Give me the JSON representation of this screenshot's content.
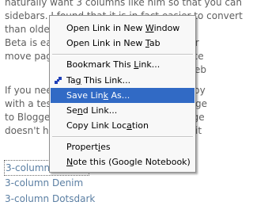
{
  "page": {
    "lines": [
      "naturally want 3 columns like him so that you can",
      "sidebars. I found that it is in fact easier to convert",
      "than older Blogger templates because",
      "Beta is easier",
      "move page elements",
      "If you need",
      "with a test",
      "to Blogger",
      "doesn't have"
    ],
    "right_fragments": [
      "ler",
      "nce",
      "eb",
      "by",
      "ge",
      "nge",
      "it"
    ],
    "links": [
      "3-column Minima",
      "3-column Denim",
      "3-column Dotsdark"
    ]
  },
  "context_menu": {
    "items": [
      {
        "label": "Open Link in New Window",
        "underline": "W"
      },
      {
        "label": "Open Link in New Tab",
        "underline": "T"
      },
      {
        "label": "Bookmark This Link...",
        "underline": "L"
      },
      {
        "label": "Tag This Link...",
        "underline": "g"
      },
      {
        "label": "Save Link As...",
        "underline": "k"
      },
      {
        "label": "Send Link...",
        "underline": "n"
      },
      {
        "label": "Copy Link Location",
        "underline": "a"
      },
      {
        "label": "Properties",
        "underline": "i"
      },
      {
        "label": "Note this (Google Notebook)",
        "underline": "N"
      }
    ],
    "selected_label": "Save Link As...",
    "tag_icon": "tag-icon",
    "colors": {
      "highlight": "#316ac5",
      "link": "#5b7fa3"
    }
  }
}
